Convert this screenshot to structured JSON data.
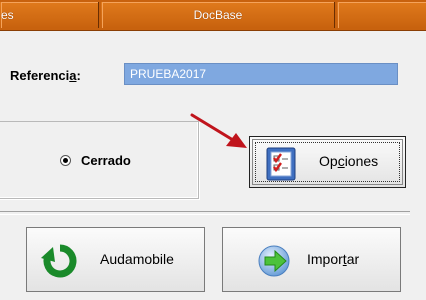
{
  "tabs": [
    {
      "label": "es"
    },
    {
      "label": "DocBase"
    },
    {
      "label": ""
    }
  ],
  "referencia": {
    "label_pre": "Referenci",
    "label_underlined": "a",
    "label_post": ":",
    "value": "PRUEBA2017"
  },
  "radio": {
    "label": "Cerrado",
    "checked": true
  },
  "buttons": {
    "opciones_pre": "Op",
    "opciones_underlined": "c",
    "opciones_post": "iones",
    "audamobile": "Audamobile",
    "importar_pre": "Impor",
    "importar_underlined": "t",
    "importar_post": "ar"
  },
  "colors": {
    "tab_orange": "#c8620e",
    "input_blue": "#7fa8e0",
    "arrow_red": "#c0141c"
  },
  "icons": {
    "opciones": "checklist-icon",
    "audamobile": "refresh-icon",
    "importar": "import-arrow-icon"
  }
}
